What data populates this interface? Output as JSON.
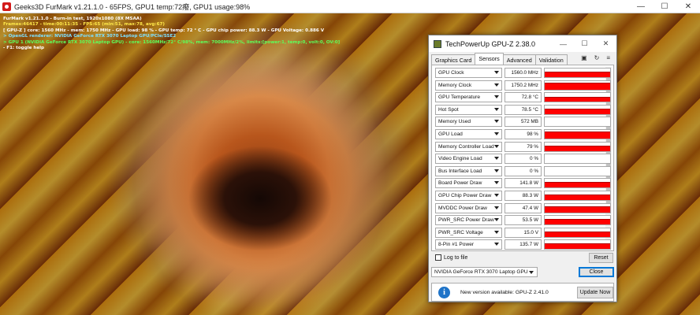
{
  "window": {
    "title": "Geeks3D FurMark v1.21.1.0 - 65FPS, GPU1 temp:72癈, GPU1 usage:98%",
    "controls": {
      "minimize": "—",
      "maximize": "☐",
      "close": "✕"
    }
  },
  "overlay": {
    "lines": [
      "FurMark v1.21.1.0 - Burn-in test, 1920x1080 (8X MSAA)",
      "Frames:46417 - time:00:11:35 - FPS:65 (min:51, max:78, avg:67)",
      "[ GPU-Z ] core: 1560 MHz - mem: 1750 MHz - GPU load: 98 % - GPU temp: 72 ° C - GPU chip power: 88.3 W - GPU Voltage: 0.886 V",
      "> OpenGL renderer: NVIDIA GeForce RTX 3070 Laptop GPU/PCIe/SSE2",
      "> GPU 1 (NVIDIA GeForce RTX 3070 Laptop GPU) - core: 1560MHz/72° C/98%, mem: 7000MHz/2%, limits:[power:1, temp:0, volt:0, OV:0]",
      "- F1: toggle help"
    ]
  },
  "gpuz": {
    "title": "TechPowerUp GPU-Z 2.38.0",
    "controls": {
      "minimize": "—",
      "maximize": "☐",
      "close": "✕"
    },
    "tabs": [
      "Graphics Card",
      "Sensors",
      "Advanced",
      "Validation"
    ],
    "active_tab": "Sensors",
    "tab_icons": {
      "camera": "▣",
      "refresh": "↻",
      "menu": "≡"
    },
    "sensors": [
      {
        "label": "GPU Clock",
        "value": "1560.0 MHz",
        "fill": 0.6
      },
      {
        "label": "Memory Clock",
        "value": "1750.2 MHz",
        "fill": 0.8
      },
      {
        "label": "GPU Temperature",
        "value": "72.8 °C",
        "fill": 0.6
      },
      {
        "label": "Hot Spot",
        "value": "78.5 °C",
        "fill": 0.65
      },
      {
        "label": "Memory Used",
        "value": "572 MB",
        "fill": 0.04
      },
      {
        "label": "GPU Load",
        "value": "98 %",
        "fill": 0.8
      },
      {
        "label": "Memory Controller Load",
        "value": "79 %",
        "fill": 0.6
      },
      {
        "label": "Video Engine Load",
        "value": "0 %",
        "fill": 0
      },
      {
        "label": "Bus Interface Load",
        "value": "0 %",
        "fill": 0
      },
      {
        "label": "Board Power Draw",
        "value": "141.8 W",
        "fill": 0.65
      },
      {
        "label": "GPU Chip Power Draw",
        "value": "88.3 W",
        "fill": 0.65
      },
      {
        "label": "MVDDC Power Draw",
        "value": "47.4 W",
        "fill": 0.65
      },
      {
        "label": "PWR_SRC Power Draw",
        "value": "53.5 W",
        "fill": 0.65
      },
      {
        "label": "PWR_SRC Voltage",
        "value": "15.0 V",
        "fill": 0.65
      },
      {
        "label": "8-Pin #1 Power",
        "value": "135.7 W",
        "fill": 0.65
      }
    ],
    "log_to_file": "Log to file",
    "reset": "Reset",
    "gpu_select": "NVIDIA GeForce RTX 3070 Laptop GPU",
    "close": "Close",
    "update": {
      "icon": "i",
      "message": "New version available: GPU-Z 2.41.0",
      "button": "Update Now"
    }
  }
}
